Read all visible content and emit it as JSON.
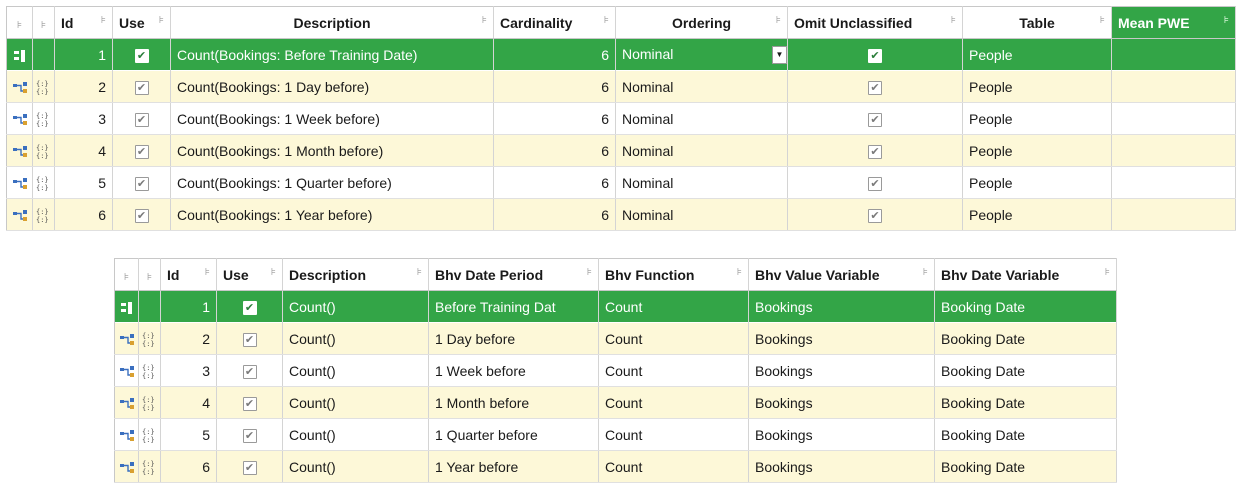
{
  "grid1": {
    "columns": {
      "pin": "⊧",
      "id": "Id",
      "use": "Use",
      "description": "Description",
      "cardinality": "Cardinality",
      "ordering": "Ordering",
      "omit": "Omit Unclassified",
      "table": "Table",
      "mean_pwe": "Mean PWE"
    },
    "rows": [
      {
        "id": "1",
        "use": "✔",
        "description": "Count(Bookings: Before Training Date)",
        "cardinality": "6",
        "ordering": "Nominal",
        "omit": "✔",
        "table": "People",
        "selected": true
      },
      {
        "id": "2",
        "use": "✔",
        "description": "Count(Bookings: 1 Day before)",
        "cardinality": "6",
        "ordering": "Nominal",
        "omit": "✔",
        "table": "People"
      },
      {
        "id": "3",
        "use": "✔",
        "description": "Count(Bookings: 1 Week before)",
        "cardinality": "6",
        "ordering": "Nominal",
        "omit": "✔",
        "table": "People"
      },
      {
        "id": "4",
        "use": "✔",
        "description": "Count(Bookings: 1 Month before)",
        "cardinality": "6",
        "ordering": "Nominal",
        "omit": "✔",
        "table": "People"
      },
      {
        "id": "5",
        "use": "✔",
        "description": "Count(Bookings: 1 Quarter before)",
        "cardinality": "6",
        "ordering": "Nominal",
        "omit": "✔",
        "table": "People"
      },
      {
        "id": "6",
        "use": "✔",
        "description": "Count(Bookings: 1 Year before)",
        "cardinality": "6",
        "ordering": "Nominal",
        "omit": "✔",
        "table": "People"
      }
    ]
  },
  "grid2": {
    "columns": {
      "pin": "⊧",
      "id": "Id",
      "use": "Use",
      "description": "Description",
      "bhv_date_period": "Bhv Date Period",
      "bhv_function": "Bhv Function",
      "bhv_value_variable": "Bhv Value Variable",
      "bhv_date_variable": "Bhv Date Variable"
    },
    "rows": [
      {
        "id": "1",
        "use": "✔",
        "description": "Count()",
        "bhv_date_period": "Before Training Dat",
        "bhv_function": "Count",
        "bhv_value_variable": "Bookings",
        "bhv_date_variable": "Booking Date",
        "selected": true
      },
      {
        "id": "2",
        "use": "✔",
        "description": "Count()",
        "bhv_date_period": "1 Day before",
        "bhv_function": "Count",
        "bhv_value_variable": "Bookings",
        "bhv_date_variable": "Booking Date"
      },
      {
        "id": "3",
        "use": "✔",
        "description": "Count()",
        "bhv_date_period": "1 Week before",
        "bhv_function": "Count",
        "bhv_value_variable": "Bookings",
        "bhv_date_variable": "Booking Date"
      },
      {
        "id": "4",
        "use": "✔",
        "description": "Count()",
        "bhv_date_period": "1 Month before",
        "bhv_function": "Count",
        "bhv_value_variable": "Bookings",
        "bhv_date_variable": "Booking Date"
      },
      {
        "id": "5",
        "use": "✔",
        "description": "Count()",
        "bhv_date_period": "1 Quarter before",
        "bhv_function": "Count",
        "bhv_value_variable": "Bookings",
        "bhv_date_variable": "Booking Date"
      },
      {
        "id": "6",
        "use": "✔",
        "description": "Count()",
        "bhv_date_period": "1 Year before",
        "bhv_function": "Count",
        "bhv_value_variable": "Bookings",
        "bhv_date_variable": "Booking Date"
      }
    ]
  },
  "icons": {
    "row_indicator": "row-link-icon",
    "row_variable": "braces-variable-icon",
    "current_row": "current-row-icon",
    "column_pin": "column-pin-icon",
    "dropdown": "chevron-down-icon"
  },
  "colors": {
    "selection": "#33a547",
    "alt_row": "#fdf8d8",
    "header_accent": "#33a547"
  }
}
